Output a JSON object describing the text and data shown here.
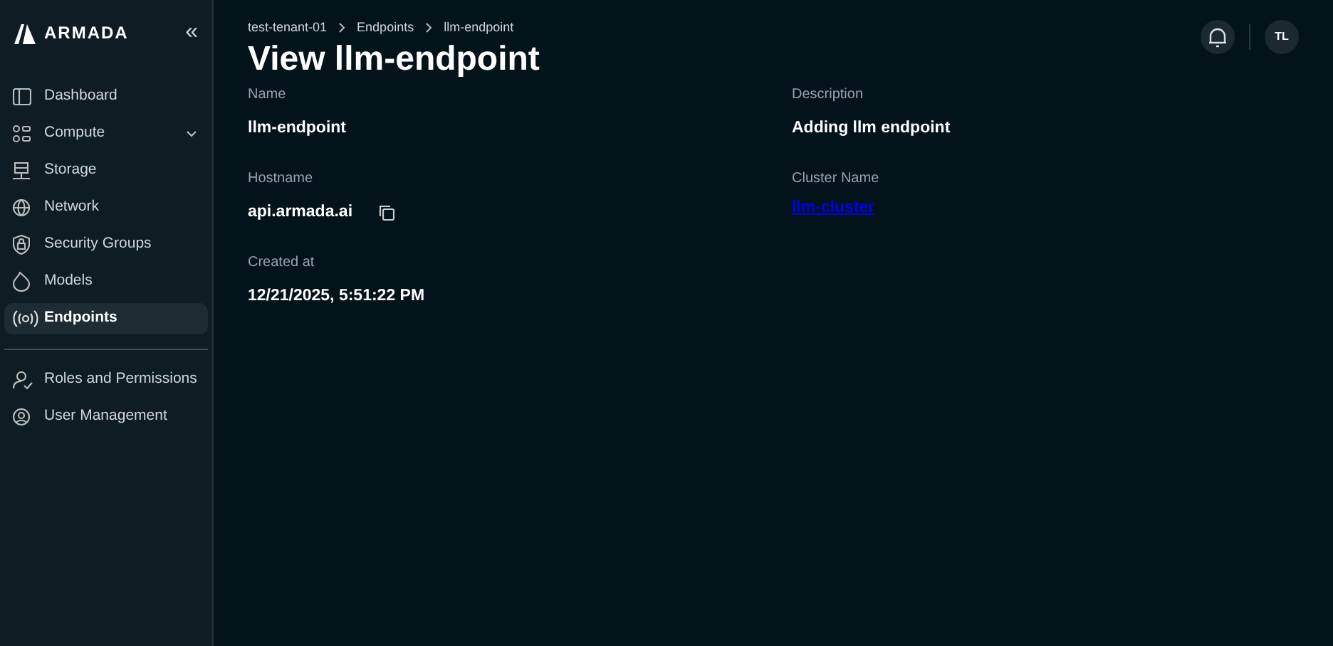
{
  "sidebar": {
    "logo": "ARMADA",
    "collapse": "«",
    "items": [
      {
        "label": "Dashboard",
        "selected": false
      },
      {
        "label": "Compute",
        "selected": false,
        "expandable": true
      },
      {
        "label": "Storage",
        "selected": false
      },
      {
        "label": "Network",
        "selected": false
      },
      {
        "label": "Security Groups",
        "selected": false
      },
      {
        "label": "Models",
        "selected": false
      },
      {
        "label": "Endpoints",
        "selected": true
      }
    ],
    "bottom_items": [
      {
        "label": "Roles and Permissions",
        "selected": false
      },
      {
        "label": "User Management",
        "selected": false
      }
    ]
  },
  "breadcrumb": [
    "test-tenant-01",
    "Endpoints",
    "llm-endpoint"
  ],
  "title": "View llm-endpoint",
  "header": {
    "avatar": "TL"
  },
  "fields": [
    {
      "label": "Name",
      "value": "llm-endpoint",
      "kind": "text"
    },
    {
      "label": "Description",
      "value": "Adding llm endpoint",
      "kind": "text"
    },
    {
      "label": "Hostname",
      "value": "api.armada.ai",
      "kind": "copyable"
    },
    {
      "label": "Cluster Name",
      "value": "llm-cluster",
      "kind": "link"
    },
    {
      "label": "Created at",
      "value": "12/21/2025, 5:51:22 PM",
      "kind": "text"
    }
  ]
}
